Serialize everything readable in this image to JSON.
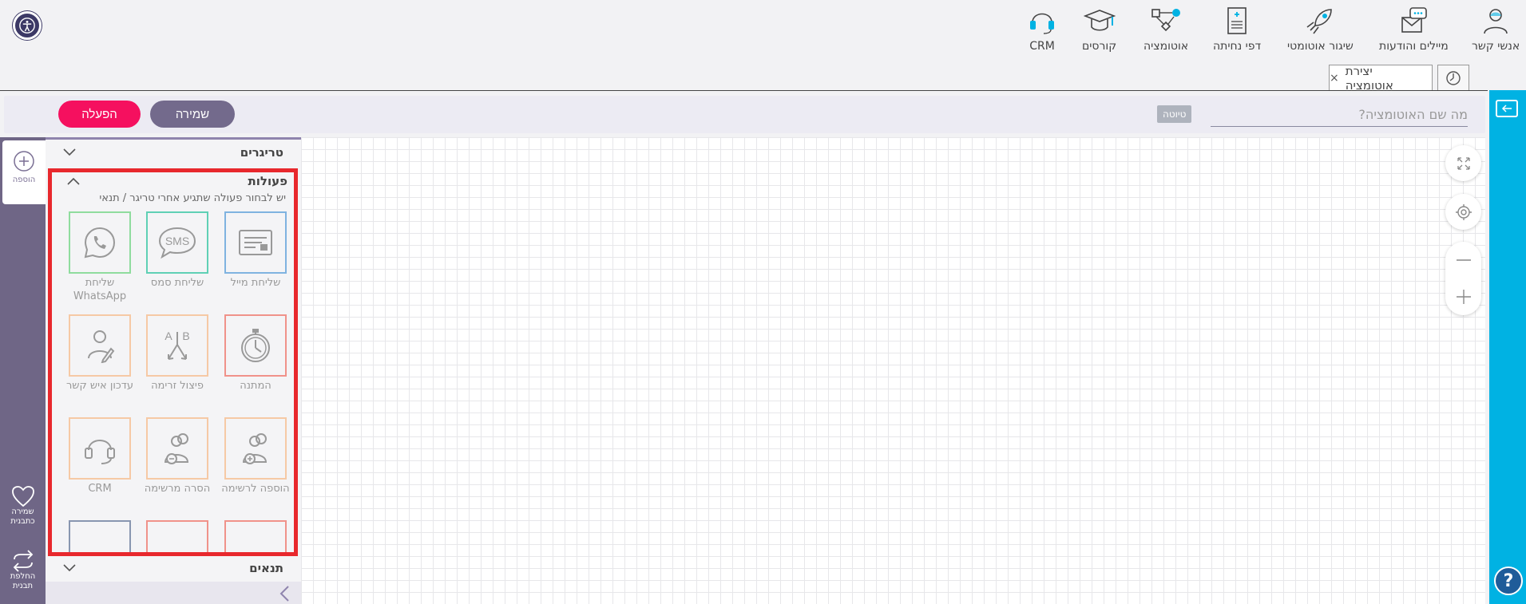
{
  "nav": {
    "items": [
      {
        "label": "אנשי קשר",
        "icon": "contacts-icon"
      },
      {
        "label": "מיילים והודעות",
        "icon": "emails-icon"
      },
      {
        "label": "שיגור אוטומטי",
        "icon": "rocket-icon"
      },
      {
        "label": "דפי נחיתה",
        "icon": "landing-page-icon"
      },
      {
        "label": "אוטומציה",
        "icon": "automation-icon"
      },
      {
        "label": "קורסים",
        "icon": "graduation-cap-icon"
      },
      {
        "label": "CRM",
        "icon": "headset-icon"
      }
    ]
  },
  "tabs": {
    "active_label": "יצירת אוטומציה",
    "close_symbol": "×"
  },
  "toolbar": {
    "activate_label": "הפעלה",
    "save_label": "שמירה",
    "draft_badge": "טיוטה",
    "name_placeholder": "מה שם האוטומציה?"
  },
  "left_rail": {
    "add_label": "הוספה",
    "save_template_label": "שמירה כתבנית",
    "switch_template_label": "החלפת תבנית"
  },
  "panel": {
    "triggers_title": "טריגרים",
    "actions_title": "פעולות",
    "actions_hint": "יש לבחור פעולה שתגיע אחרי טריגר / תנאי",
    "conditions_title": "תנאים",
    "actions": [
      {
        "label": "שליחת מייל",
        "icon": "email-card-icon",
        "color": "#7fb3e0"
      },
      {
        "label": "שליחת סמס",
        "icon": "sms-icon",
        "color": "#5fd0b5"
      },
      {
        "label": "שליחת WhatsApp",
        "icon": "whatsapp-icon",
        "color": "#8fdc9e"
      },
      {
        "label": "המתנה",
        "icon": "stopwatch-icon",
        "color": "#f0928a"
      },
      {
        "label": "פיצול זרימה",
        "icon": "ab-split-icon",
        "color": "#f6c9a5"
      },
      {
        "label": "עדכון איש קשר",
        "icon": "edit-contact-icon",
        "color": "#f6c9a5"
      },
      {
        "label": "הוספה לרשימה",
        "icon": "add-to-list-icon",
        "color": "#f6c9a5"
      },
      {
        "label": "הסרה מרשימה",
        "icon": "remove-from-list-icon",
        "color": "#f6c9a5"
      },
      {
        "label": "CRM",
        "icon": "headset-icon",
        "color": "#f6c9a5"
      }
    ]
  },
  "colors": {
    "accent_pink": "#f5105f",
    "save_purple": "#736a8c",
    "rail_purple": "#6f6686",
    "cyan": "#00b2e3",
    "highlight_red": "#e8282d"
  }
}
